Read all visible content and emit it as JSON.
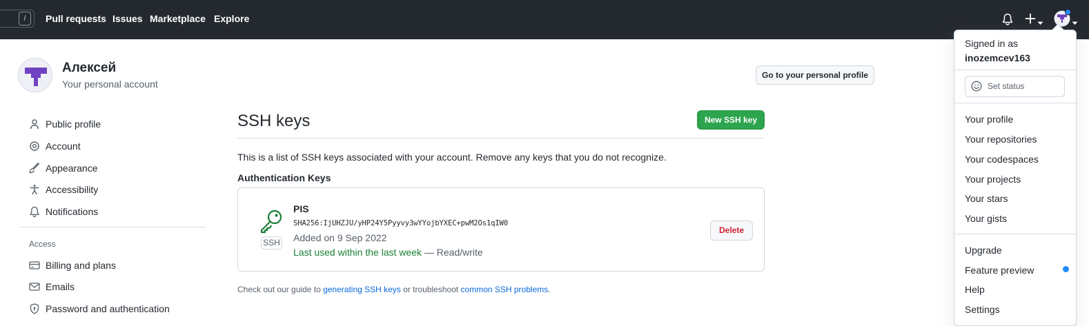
{
  "header": {
    "search_shortcut": "/",
    "nav": [
      "Pull requests",
      "Issues",
      "Marketplace",
      "Explore"
    ],
    "icons": [
      "bell-icon",
      "plus-icon",
      "caret-down-icon",
      "avatar"
    ]
  },
  "account": {
    "name": "Алексей",
    "subtitle": "Your personal account",
    "profile_button": "Go to your personal profile"
  },
  "sidebar": {
    "items": [
      {
        "label": "Public profile",
        "icon": "person-icon"
      },
      {
        "label": "Account",
        "icon": "gear-icon"
      },
      {
        "label": "Appearance",
        "icon": "paintbrush-icon"
      },
      {
        "label": "Accessibility",
        "icon": "accessibility-icon"
      },
      {
        "label": "Notifications",
        "icon": "bell-icon"
      }
    ],
    "access_heading": "Access",
    "access_items": [
      {
        "label": "Billing and plans",
        "icon": "credit-card-icon"
      },
      {
        "label": "Emails",
        "icon": "mail-icon"
      },
      {
        "label": "Password and authentication",
        "icon": "shield-lock-icon"
      }
    ]
  },
  "main": {
    "title": "SSH keys",
    "new_key_button": "New SSH key",
    "description": "This is a list of SSH keys associated with your account. Remove any keys that you do not recognize.",
    "auth_heading": "Authentication Keys",
    "key": {
      "icon": "key-icon",
      "badge": "SSH",
      "title": "PIS",
      "fingerprint": "SHA256:IjUHZJU/yHP24Y5Pyyvy3wYYojbYXEC+pwM2Os1qIW0",
      "added": "Added on 9 Sep 2022",
      "last_used": "Last used within the last week",
      "access": " — Read/write",
      "delete_button": "Delete"
    },
    "footer": {
      "prefix": "Check out our guide to ",
      "link1": "generating SSH keys",
      "middle": " or troubleshoot ",
      "link2": "common SSH problems",
      "suffix": "."
    }
  },
  "dropdown": {
    "signed_in_as": "Signed in as",
    "username": "inozemcev163",
    "set_status": "Set status",
    "group1": [
      "Your profile",
      "Your repositories",
      "Your codespaces",
      "Your projects",
      "Your stars",
      "Your gists"
    ],
    "group2": [
      "Upgrade",
      "Feature preview",
      "Help",
      "Settings"
    ]
  },
  "colors": {
    "header_bg": "#24292f",
    "primary_green": "#2da44e",
    "link_blue": "#0969da",
    "danger_red": "#cf222e",
    "avatar_purple": "#6f42c1",
    "notice_dot": "#218bff"
  }
}
